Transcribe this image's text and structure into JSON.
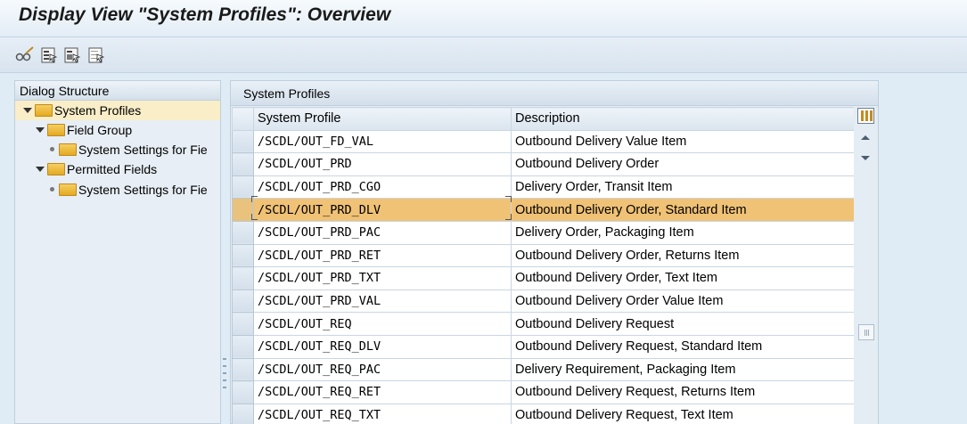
{
  "window": {
    "title": "Display View \"System Profiles\": Overview"
  },
  "toolbar": {
    "buttons": [
      {
        "icon": "glasses-pencil-icon"
      },
      {
        "icon": "select-all-icon"
      },
      {
        "icon": "select-block-icon"
      },
      {
        "icon": "deselect-all-icon"
      }
    ]
  },
  "dialog_structure": {
    "header": "Dialog Structure",
    "items": [
      {
        "label": "System Profiles",
        "level": 0,
        "expanded": true,
        "selected": true
      },
      {
        "label": "Field Group",
        "level": 1,
        "expanded": true
      },
      {
        "label": "System Settings for Fie",
        "level": 2
      },
      {
        "label": "Permitted Fields",
        "level": 1,
        "expanded": true
      },
      {
        "label": "System Settings for Fie",
        "level": 2
      }
    ]
  },
  "main": {
    "panel_title": "System Profiles",
    "columns": [
      "System Profile",
      "Description"
    ],
    "rows": [
      {
        "profile": "/SCDL/OUT_FD_VAL",
        "description": "Outbound Delivery Value Item"
      },
      {
        "profile": "/SCDL/OUT_PRD",
        "description": "Outbound Delivery Order"
      },
      {
        "profile": "/SCDL/OUT_PRD_CGO",
        "description": "Delivery Order, Transit Item"
      },
      {
        "profile": "/SCDL/OUT_PRD_DLV",
        "description": "Outbound Delivery Order, Standard Item",
        "highlighted": true
      },
      {
        "profile": "/SCDL/OUT_PRD_PAC",
        "description": "Delivery Order, Packaging Item"
      },
      {
        "profile": "/SCDL/OUT_PRD_RET",
        "description": "Outbound Delivery Order, Returns Item"
      },
      {
        "profile": "/SCDL/OUT_PRD_TXT",
        "description": "Outbound Delivery Order, Text Item"
      },
      {
        "profile": "/SCDL/OUT_PRD_VAL",
        "description": "Outbound Delivery Order Value Item"
      },
      {
        "profile": "/SCDL/OUT_REQ",
        "description": "Outbound Delivery Request"
      },
      {
        "profile": "/SCDL/OUT_REQ_DLV",
        "description": "Outbound Delivery Request, Standard Item"
      },
      {
        "profile": "/SCDL/OUT_REQ_PAC",
        "description": "Delivery Requirement, Packaging Item"
      },
      {
        "profile": "/SCDL/OUT_REQ_RET",
        "description": "Outbound Delivery Request, Returns Item"
      },
      {
        "profile": "/SCDL/OUT_REQ_TXT",
        "description": "Outbound Delivery Request, Text Item"
      }
    ]
  },
  "colors": {
    "highlight": "#f0c276",
    "tree_selected": "#f9eec8",
    "background": "#dfebf5"
  }
}
